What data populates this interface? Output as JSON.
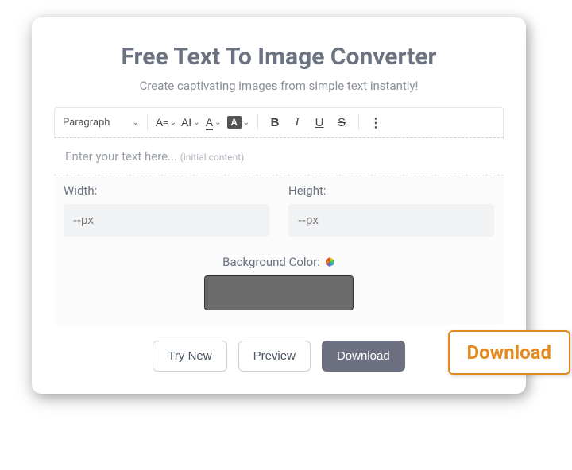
{
  "header": {
    "title": "Free Text To Image Converter",
    "subtitle": "Create captivating images from simple text instantly!"
  },
  "toolbar": {
    "block_style": "Paragraph",
    "font_family_label": "A",
    "font_size_label": "AI",
    "text_color_label": "A",
    "highlight_label": "A",
    "bold_label": "B",
    "italic_label": "I",
    "underline_label": "U",
    "strike_label": "S",
    "more_label": "⋮"
  },
  "editor": {
    "placeholder": "Enter your text here...",
    "hint": "(initial content)"
  },
  "dimensions": {
    "width_label": "Width:",
    "width_placeholder": "--px",
    "height_label": "Height:",
    "height_placeholder": "--px"
  },
  "background": {
    "label": "Background Color:",
    "value": "#6b6b6b"
  },
  "actions": {
    "try_new": "Try New",
    "preview": "Preview",
    "download": "Download"
  },
  "callout": {
    "label": "Download"
  }
}
